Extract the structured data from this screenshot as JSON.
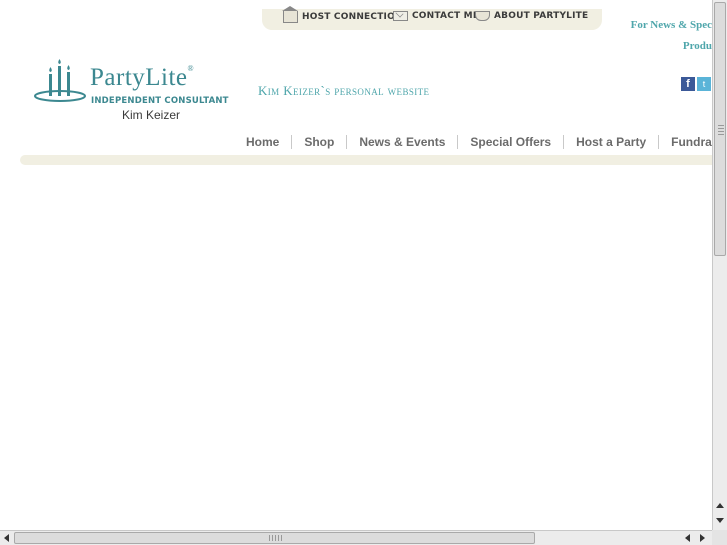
{
  "topbar": {
    "links": [
      {
        "label": "HOST CONNECTION",
        "icon": "house-icon"
      },
      {
        "label": "CONTACT ME",
        "icon": "envelope-icon"
      },
      {
        "label": "ABOUT PARTYLITE",
        "icon": "cup-icon"
      }
    ]
  },
  "promo": {
    "line1": "For News & Spec",
    "line2": "Produ"
  },
  "logo": {
    "brand": "PartyLite",
    "tagline": "INDEPENDENT CONSULTANT",
    "consultant_name": "Kim Keizer"
  },
  "site_title": "Kim Keizer`s personal website",
  "social": {
    "facebook": "f",
    "twitter": "t"
  },
  "nav": {
    "items": [
      "Home",
      "Shop",
      "News & Events",
      "Special Offers",
      "Host a Party",
      "Fundra"
    ]
  },
  "colors": {
    "accent": "#3c8890",
    "accent_light": "#4fa6ab",
    "band": "#f1efe2"
  }
}
